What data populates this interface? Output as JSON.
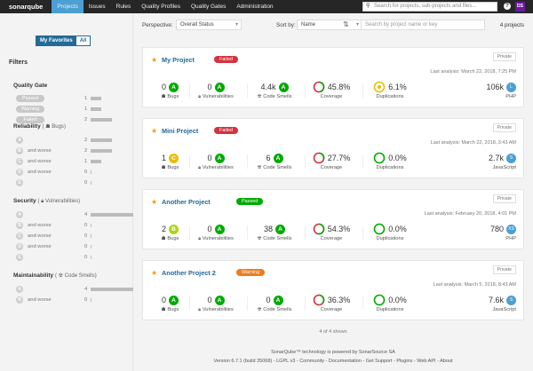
{
  "nav": {
    "logo": "sonarqube",
    "items": [
      "Projects",
      "Issues",
      "Rules",
      "Quality Profiles",
      "Quality Gates",
      "Administration"
    ],
    "active": 0,
    "search_placeholder": "Search for projects, sub-projects and files...",
    "help": "?",
    "avatar": "DS"
  },
  "sidebar": {
    "fav": "My Favorites",
    "all": "All",
    "filters": "Filters",
    "quality_gate": {
      "title": "Quality Gate",
      "rows": [
        {
          "label": "Passed",
          "count": "1",
          "frac": 0.25
        },
        {
          "label": "Warning",
          "count": "1",
          "frac": 0.25
        },
        {
          "label": "Failed",
          "count": "2",
          "frac": 0.5
        }
      ]
    },
    "reliability": {
      "title": "Reliability",
      "open": "(",
      "sub": "Bugs",
      "close": ")",
      "rows": [
        {
          "r": "A",
          "t": "",
          "count": "2",
          "frac": 0.5
        },
        {
          "r": "B",
          "t": "and worse",
          "count": "2",
          "frac": 0.5
        },
        {
          "r": "C",
          "t": "and worse",
          "count": "1",
          "frac": 0.25
        },
        {
          "r": "D",
          "t": "and worse",
          "count": "0",
          "frac": 0
        },
        {
          "r": "E",
          "t": "",
          "count": "0",
          "frac": 0
        }
      ]
    },
    "security": {
      "title": "Security",
      "open": "(",
      "sub": "Vulnerabilities",
      "close": ")",
      "rows": [
        {
          "r": "A",
          "t": "",
          "count": "4",
          "frac": 1
        },
        {
          "r": "B",
          "t": "and worse",
          "count": "0",
          "frac": 0
        },
        {
          "r": "C",
          "t": "and worse",
          "count": "0",
          "frac": 0
        },
        {
          "r": "D",
          "t": "and worse",
          "count": "0",
          "frac": 0
        },
        {
          "r": "E",
          "t": "",
          "count": "0",
          "frac": 0
        }
      ]
    },
    "maintainability": {
      "title": "Maintainability",
      "open": "(",
      "sub": "Code Smells",
      "close": ")",
      "rows": [
        {
          "r": "A",
          "t": "",
          "count": "4",
          "frac": 1
        },
        {
          "r": "B",
          "t": "and worse",
          "count": "0",
          "frac": 0
        }
      ]
    }
  },
  "toolbar": {
    "perspective_label": "Perspective:",
    "perspective": "Overall Status",
    "sort_label": "Sort by:",
    "sort": "Name",
    "search_placeholder": "Search by project name or key",
    "count": "4 projects"
  },
  "labels": {
    "bugs": "Bugs",
    "vulns": "Vulnerabilities",
    "smells": "Code Smells",
    "coverage": "Coverage",
    "dup": "Duplications"
  },
  "colors": {
    "A": "#00aa00",
    "B": "#b0d513",
    "C": "#eabe06",
    "passed": "#00aa00",
    "failed": "#d4333f",
    "warning": "#ed7d20"
  },
  "projects": [
    {
      "name": "My Project",
      "gate": "Failed",
      "gate_status": "failed",
      "visibility": "Private",
      "last": "Last analysis: March 22, 2018, 7:25 PM",
      "bugs": "0",
      "bugs_r": "A",
      "vulns": "0",
      "vulns_r": "A",
      "smells": "4.4k",
      "smells_r": "A",
      "coverage": "45.8%",
      "cov": 45.8,
      "dup": "6.1%",
      "dupv": 6.1,
      "size": "106k",
      "size_r": "L",
      "lang": "PHP"
    },
    {
      "name": "Mini Project",
      "gate": "Failed",
      "gate_status": "failed",
      "visibility": "Private",
      "last": "Last analysis: March 22, 2018, 3:43 AM",
      "bugs": "1",
      "bugs_r": "C",
      "vulns": "0",
      "vulns_r": "A",
      "smells": "6",
      "smells_r": "A",
      "coverage": "27.7%",
      "cov": 27.7,
      "dup": "0.0%",
      "dupv": 0,
      "size": "2.7k",
      "size_r": "S",
      "lang": "JavaScript"
    },
    {
      "name": "Another Project",
      "gate": "Passed",
      "gate_status": "passed",
      "visibility": "Private",
      "last": "Last analysis: February 20, 2018, 4:01 PM",
      "bugs": "2",
      "bugs_r": "B",
      "vulns": "0",
      "vulns_r": "A",
      "smells": "38",
      "smells_r": "A",
      "coverage": "54.3%",
      "cov": 54.3,
      "dup": "0.0%",
      "dupv": 0,
      "size": "780",
      "size_r": "XS",
      "lang": "PHP"
    },
    {
      "name": "Another Project 2",
      "gate": "Warning",
      "gate_status": "warning",
      "visibility": "Private",
      "last": "Last analysis: March 5, 2018, 8:43 AM",
      "bugs": "0",
      "bugs_r": "A",
      "vulns": "0",
      "vulns_r": "A",
      "smells": "0",
      "smells_r": "A",
      "coverage": "36.3%",
      "cov": 36.3,
      "dup": "0.0%",
      "dupv": 0,
      "size": "7.6k",
      "size_r": "S",
      "lang": "JavaScript"
    }
  ],
  "shown": "4 of 4 shown",
  "footer": {
    "line1": "SonarQube™ technology is powered by SonarSource SA",
    "line2": "Version 6.7.1 (build 35068) - LGPL v3 - Community - Documentation - Get Support - Plugins - Web API - About"
  }
}
